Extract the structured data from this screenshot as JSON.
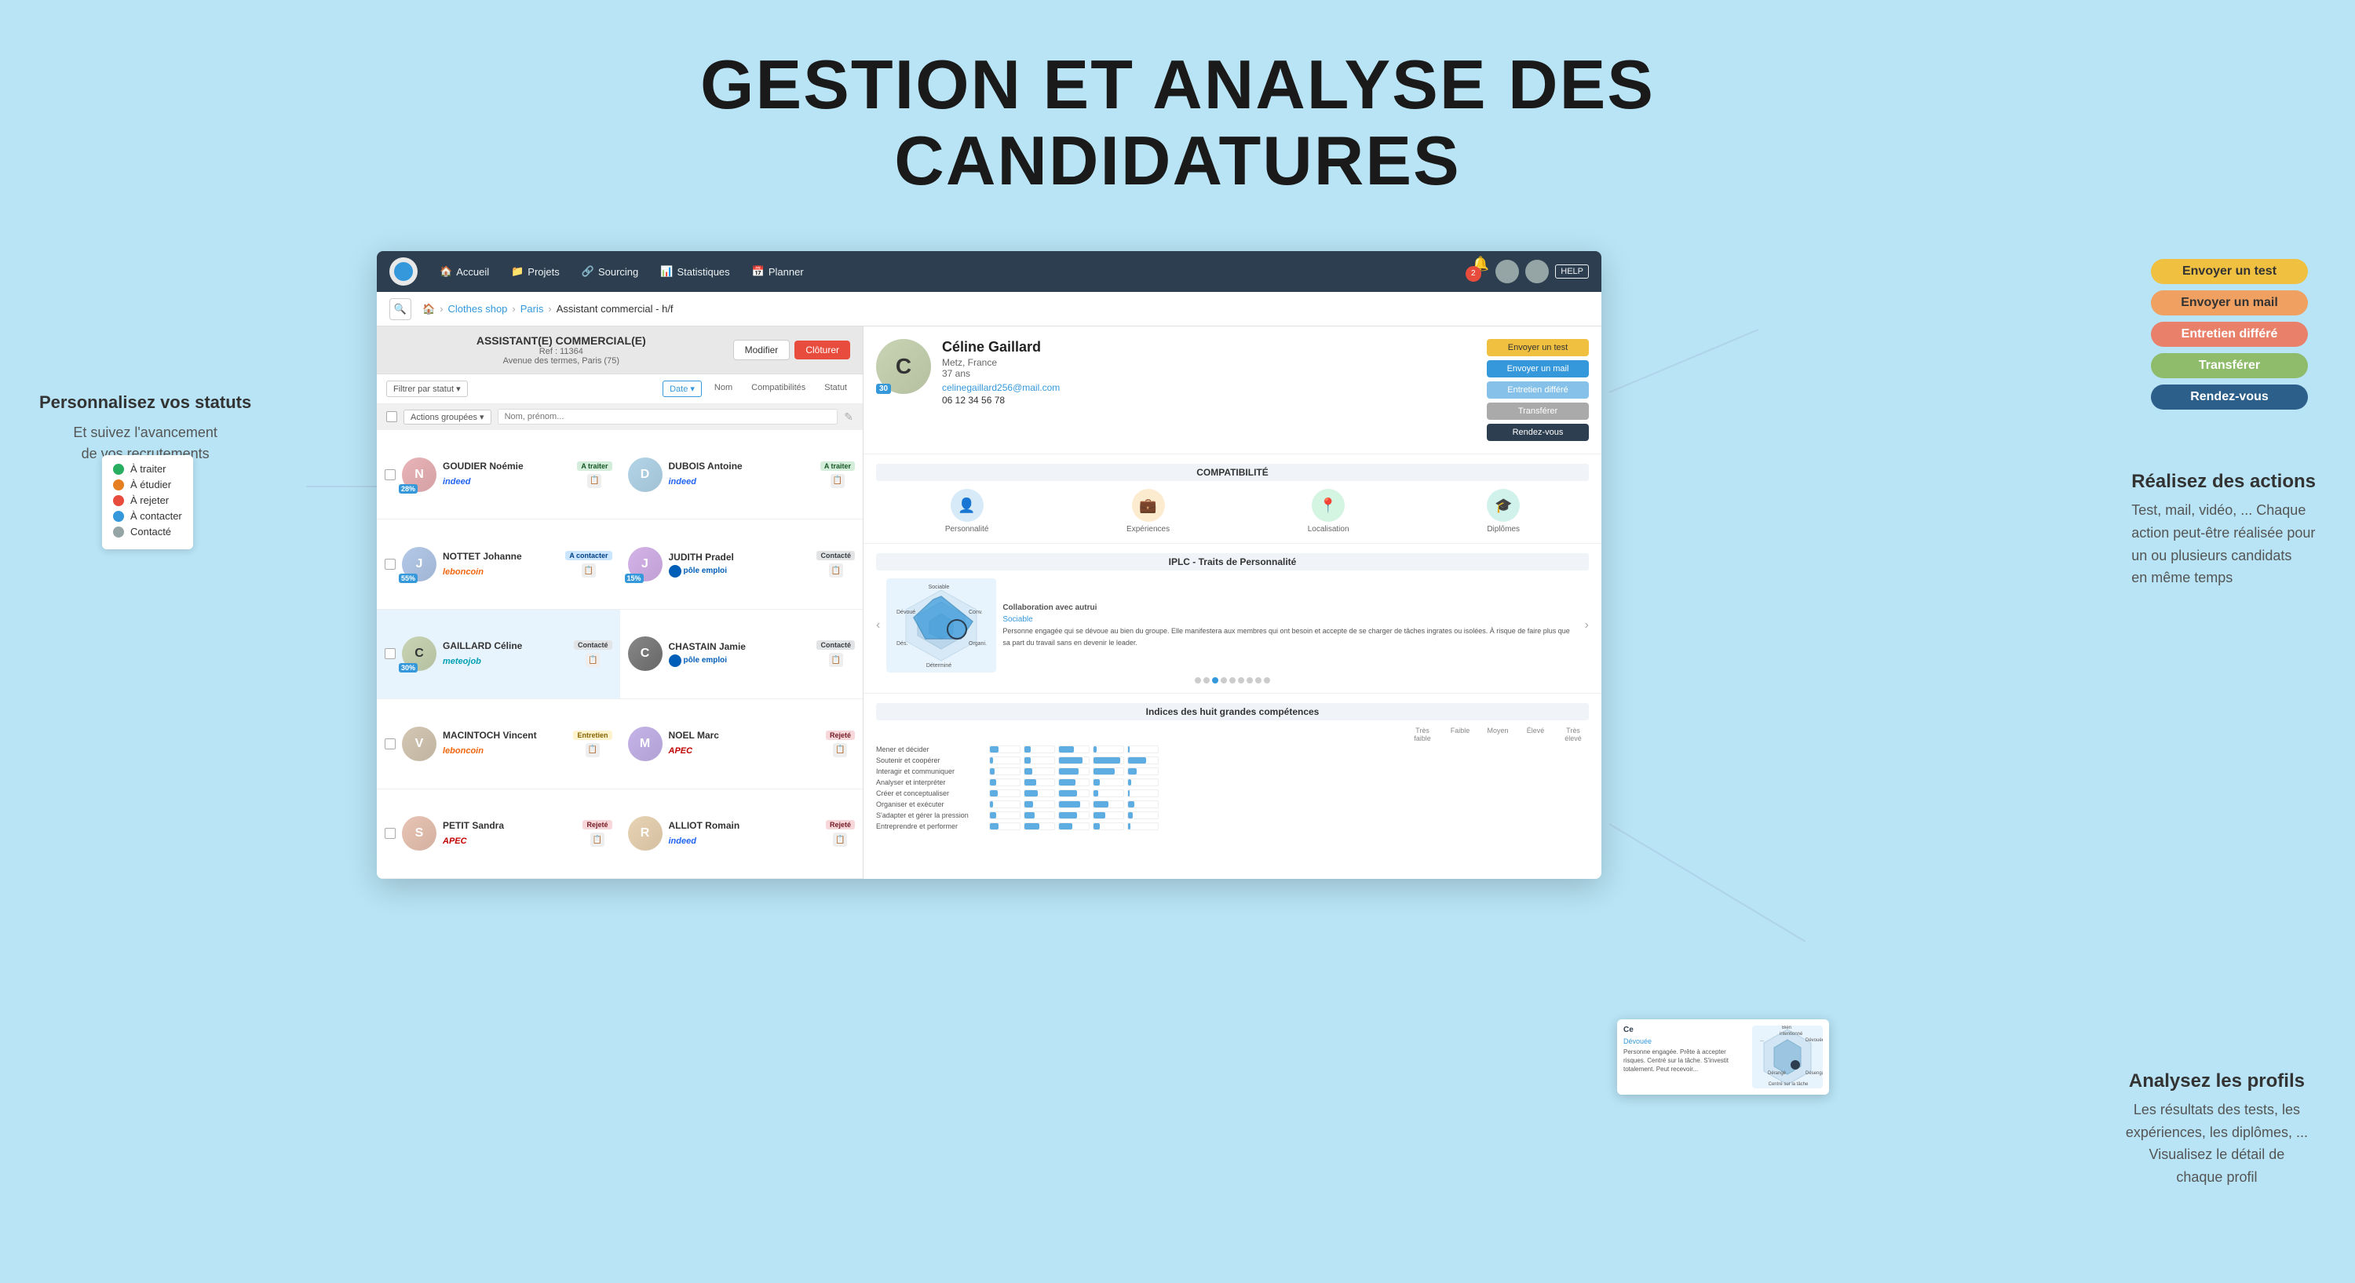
{
  "page": {
    "background_color": "#b8e4f5",
    "title": {
      "line1": "GESTION ET ANALYSE DES",
      "line2": "CANDIDATURES"
    }
  },
  "nav": {
    "logo_alt": "Logo",
    "items": [
      {
        "label": "Accueil",
        "icon": "🏠"
      },
      {
        "label": "Projets",
        "icon": "📁"
      },
      {
        "label": "Sourcing",
        "icon": "🔗"
      },
      {
        "label": "Statistiques",
        "icon": "📊"
      },
      {
        "label": "Planner",
        "icon": "📅"
      }
    ],
    "help_label": "HELP",
    "badge_count": "2"
  },
  "breadcrumb": {
    "home_icon": "🏠",
    "items": [
      "Clothes shop",
      "Paris",
      "Assistant commercial - h/f"
    ],
    "search_placeholder": "Rechercher..."
  },
  "job": {
    "title": "ASSISTANT(E) COMMERCIAL(E)",
    "ref": "Ref : 11364",
    "address": "Avenue des termes, Paris (75)",
    "btn_modifier": "Modifier",
    "btn_cloturer": "Clôturer"
  },
  "filters": {
    "filter_label": "Filtrer par statut",
    "sort_options": [
      "Date",
      "Nom",
      "Compatibilités",
      "Statut"
    ],
    "selected_sort": "Date",
    "actions_label": "Actions groupées",
    "name_placeholder": "Nom, prénom..."
  },
  "candidates": [
    {
      "name": "GOUDIER Noémie",
      "source": "indeed",
      "source_label": "Indeed",
      "status": "A traiter",
      "status_class": "status-a-traiter",
      "score": "28%",
      "avatar_initial": "N",
      "avatar_class": "avatar-noemi",
      "col": 0
    },
    {
      "name": "DUBOIS Antoine",
      "source": "indeed",
      "source_label": "Indeed",
      "status": "A traiter",
      "status_class": "status-a-traiter",
      "score": "",
      "avatar_initial": "D",
      "avatar_class": "avatar-dubois",
      "col": 1
    },
    {
      "name": "NOTTET Johanne",
      "source": "leboncoin",
      "source_label": "leboncoin",
      "status": "A contacter",
      "status_class": "status-a-contacter",
      "score": "55%",
      "avatar_initial": "J",
      "avatar_class": "avatar-johanne",
      "col": 0
    },
    {
      "name": "JUDITH Pradel",
      "source": "poleemploi",
      "source_label": "pôle emploi",
      "status": "Contacté",
      "status_class": "status-contacte",
      "score": "15%",
      "avatar_initial": "J",
      "avatar_class": "avatar-judith",
      "col": 1
    },
    {
      "name": "GAILLARD Céline",
      "source": "meteojob",
      "source_label": "meteojob",
      "status": "Contacté",
      "status_class": "status-contacte",
      "score": "30%",
      "avatar_initial": "C",
      "avatar_class": "avatar-celine",
      "col": 0
    },
    {
      "name": "CHASTAIN Jamie",
      "source": "poleemploi",
      "source_label": "pôle emploi",
      "status": "Contacté",
      "status_class": "status-contacte",
      "score": "",
      "avatar_initial": "C",
      "avatar_class": "avatar-chastain",
      "col": 1
    },
    {
      "name": "MACINTOCH Vincent",
      "source": "leboncoin",
      "source_label": "leboncoin",
      "status": "Entretien",
      "status_class": "status-entretien",
      "score": "",
      "avatar_initial": "V",
      "avatar_class": "avatar-macintoch",
      "col": 0
    },
    {
      "name": "NOEL Marc",
      "source": "apec",
      "source_label": "APEC",
      "status": "Rejeté",
      "status_class": "status-rejete",
      "score": "",
      "avatar_initial": "M",
      "avatar_class": "avatar-noel",
      "col": 1
    },
    {
      "name": "PETIT Sandra",
      "source": "apec",
      "source_label": "APEC",
      "status": "Rejeté",
      "status_class": "status-rejete",
      "score": "",
      "avatar_initial": "S",
      "avatar_class": "avatar-petit",
      "col": 0
    },
    {
      "name": "ALLIOT Romain",
      "source": "indeed",
      "source_label": "Indeed",
      "status": "Rejeté",
      "status_class": "status-rejete",
      "score": "",
      "avatar_initial": "R",
      "avatar_class": "avatar-alliot",
      "col": 1
    }
  ],
  "profile": {
    "name": "Céline Gaillard",
    "location": "Metz, France",
    "age": "37 ans",
    "email": "celinegaillard256@mail.com",
    "phone": "06 12 34 56 78",
    "score": "30",
    "avatar_initial": "C"
  },
  "profile_actions": [
    {
      "label": "Envoyer un test",
      "class": "action-btn yellow"
    },
    {
      "label": "Envoyer un mail",
      "class": "action-btn blue"
    },
    {
      "label": "Entretien différé",
      "class": "action-btn light-blue"
    },
    {
      "label": "Transférer",
      "class": "action-btn grey"
    },
    {
      "label": "Rendez-vous",
      "class": "action-btn dark"
    }
  ],
  "compatibility": {
    "title": "COMPATIBILITÉ",
    "items": [
      {
        "label": "Personnalité",
        "icon": "👤",
        "class": "ci-blue"
      },
      {
        "label": "Expériences",
        "icon": "💼",
        "class": "ci-orange"
      },
      {
        "label": "Localisation",
        "icon": "📍",
        "class": "ci-green"
      },
      {
        "label": "Diplômes",
        "icon": "🎓",
        "class": "ci-sky"
      }
    ]
  },
  "iplc": {
    "title": "IPLC - Traits de Personnalité",
    "description": "Collaboration avec autrui\nSociable\nPersonne engagée qui se dévoue au bien du groupe. Elle manifestera aux membres qui ont besoin et accepte de se charger de tâches ingrates ou isolées. À risque de faire plus que sa part du travail sans en devenir le leader.",
    "dots_count": 9,
    "active_dot": 2
  },
  "competences": {
    "title": "Indices des huit grandes compétences",
    "headers": [
      "Très faible",
      "Faible",
      "Moyen",
      "Élevé",
      "Très élevé"
    ],
    "items": [
      {
        "name": "Mener et décider",
        "value": 30
      },
      {
        "name": "Soutenir et coopérer",
        "value": 75
      },
      {
        "name": "Interagir et communiquer",
        "value": 55
      },
      {
        "name": "Analyser et interpréter",
        "value": 40
      },
      {
        "name": "Créer et conceptualiser",
        "value": 45
      },
      {
        "name": "Organiser et exécuter",
        "value": 60
      },
      {
        "name": "S'adapter et gérer la pression",
        "value": 50
      },
      {
        "name": "Entreprendre et performer",
        "value": 35
      }
    ]
  },
  "left_annotation": {
    "title": "Personnalisez vos statuts",
    "subtitle": "Et suivez l'avancement\nde vos recrutements"
  },
  "status_legend": {
    "items": [
      {
        "label": "À traiter",
        "color_class": "dot-green"
      },
      {
        "label": "À étudier",
        "color_class": "dot-orange"
      },
      {
        "label": "À rejeter",
        "color_class": "dot-red"
      },
      {
        "label": "À contacter",
        "color_class": "dot-blue"
      },
      {
        "label": "Contacté",
        "color_class": "dot-grey"
      }
    ]
  },
  "right_actions": {
    "title": "Réalisez des actions",
    "description": "Test, mail, vidéo, ... Chaque\naction peut-être réalisée pour\nun ou plusieurs candidats\nen même temps",
    "pills": [
      {
        "label": "Envoyer un test",
        "class": "ap-yellow"
      },
      {
        "label": "Envoyer un mail",
        "class": "ap-light-orange"
      },
      {
        "label": "Entretien différé",
        "class": "ap-peach"
      },
      {
        "label": "Transférer",
        "class": "ap-olive"
      },
      {
        "label": "Rendez-vous",
        "class": "ap-dark-blue"
      }
    ]
  },
  "bottom_annotation": {
    "title": "Analysez les profils",
    "description": "Les résultats des tests, les\nexpériences, les diplômes, ...\nVisualisez le détail de\nchaque profil"
  }
}
